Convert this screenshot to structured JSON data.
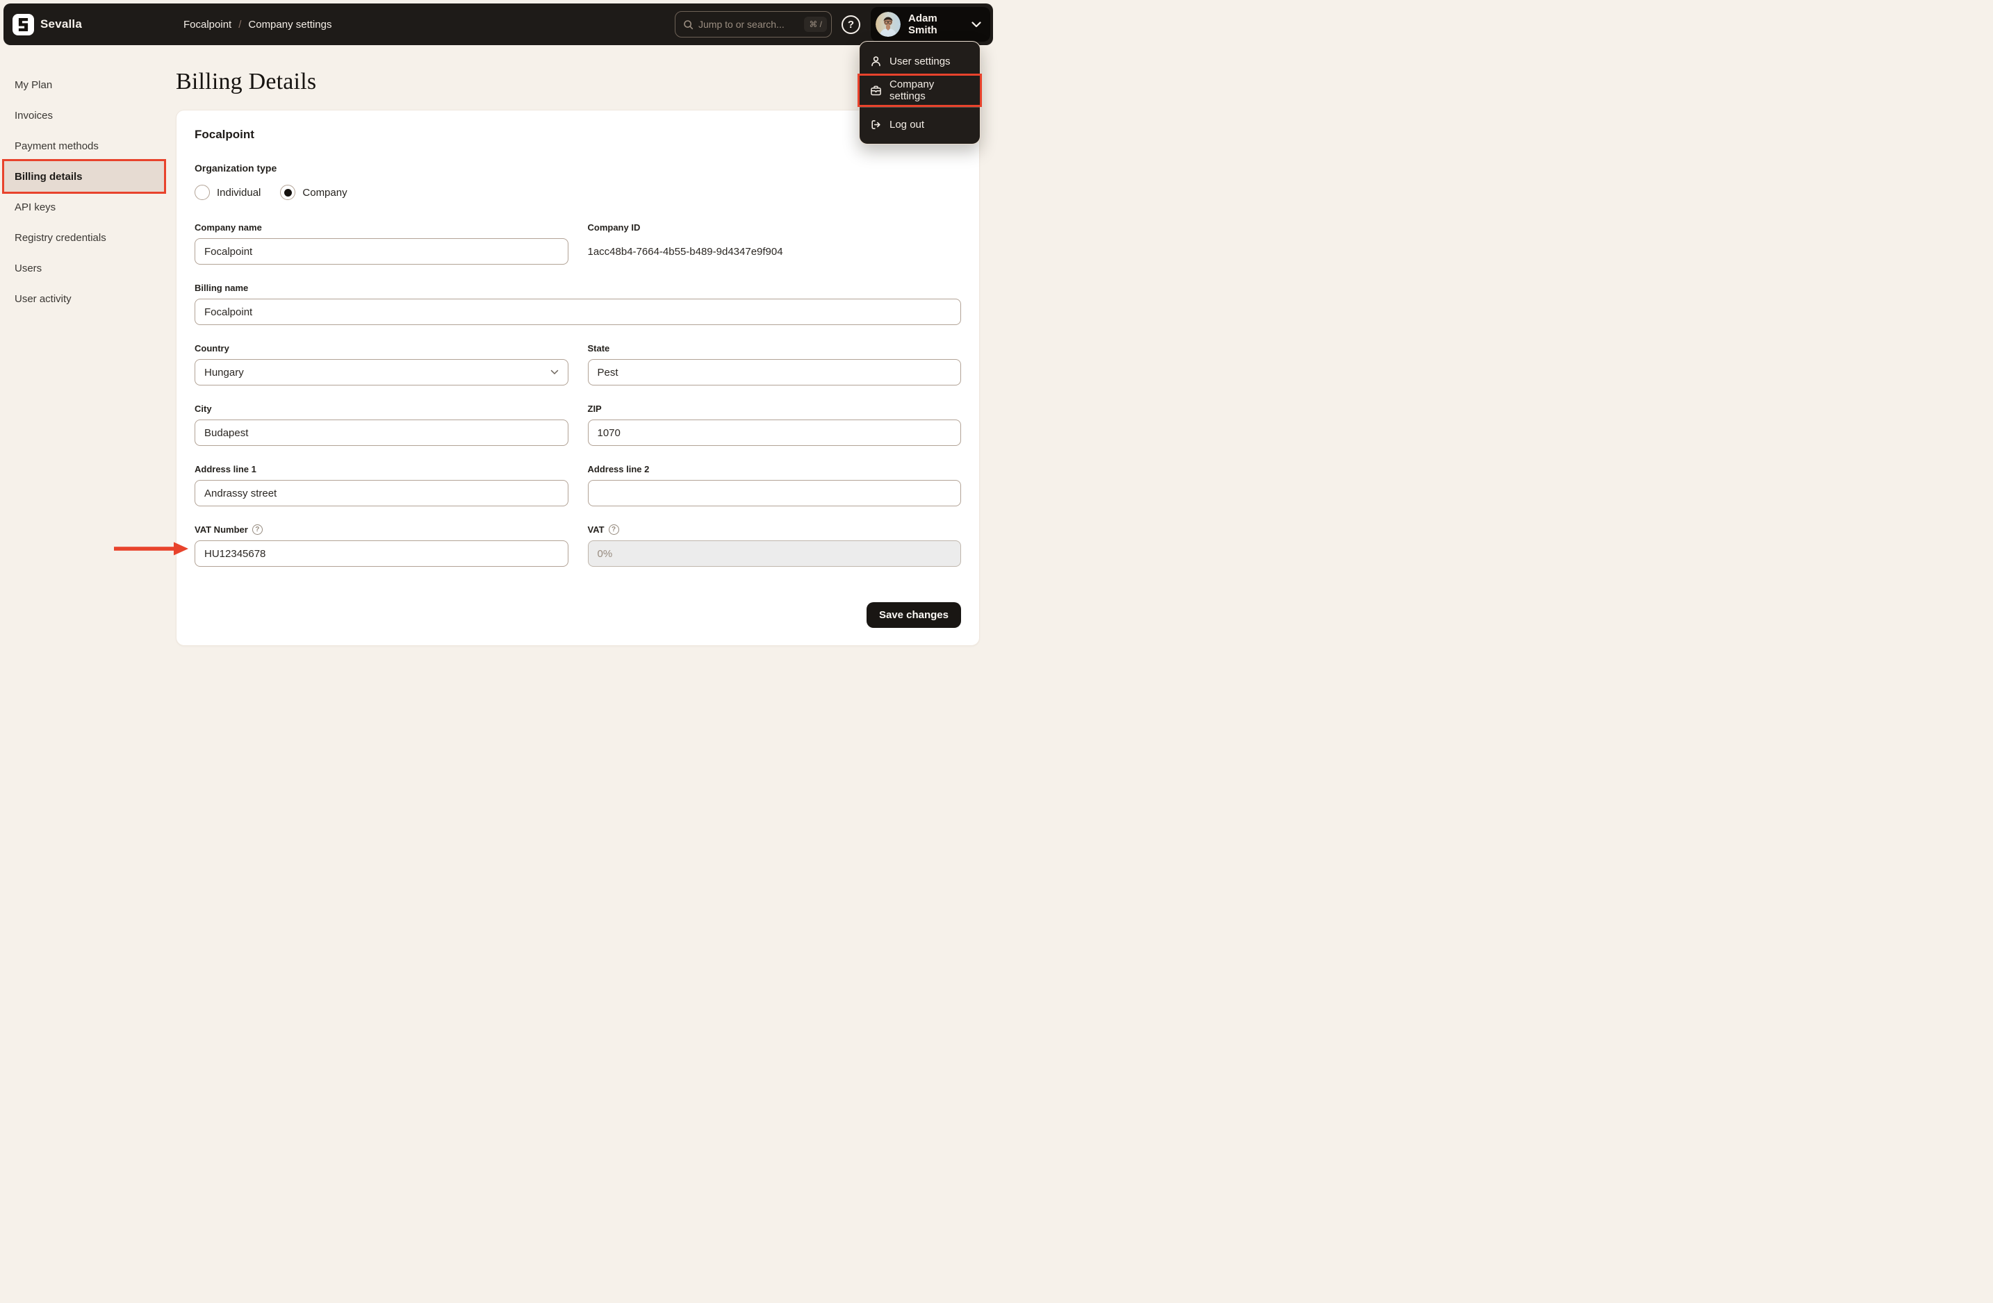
{
  "colors": {
    "page_bg": "#f6f1ea",
    "topbar_bg": "#1e1b18",
    "menu_bg": "#211d1a",
    "card_bg": "#ffffff",
    "accent_red": "#e8432c",
    "input_border": "#b2a396",
    "active_item_bg": "#e6dbd2",
    "text_dark": "#25221e",
    "text_muted": "#978b7f",
    "disabled_bg": "#ececec"
  },
  "icons": {
    "question": "?",
    "breadcrumb_separator": "/"
  },
  "topbar": {
    "brand": "Sevalla",
    "breadcrumb": [
      "Focalpoint",
      "Company settings"
    ],
    "search": {
      "placeholder": "Jump to or search...",
      "shortcut": "⌘ /"
    },
    "user_name": "Adam Smith"
  },
  "user_menu": {
    "items": [
      {
        "label": "User settings",
        "icon": "user-icon",
        "highlighted": false
      },
      {
        "label": "Company settings",
        "icon": "briefcase-icon",
        "highlighted": true
      },
      {
        "label": "Log out",
        "icon": "logout-icon",
        "highlighted": false
      }
    ]
  },
  "sidebar": {
    "items": [
      {
        "label": "My Plan",
        "active": false
      },
      {
        "label": "Invoices",
        "active": false
      },
      {
        "label": "Payment methods",
        "active": false
      },
      {
        "label": "Billing details",
        "active": true
      },
      {
        "label": "API keys",
        "active": false
      },
      {
        "label": "Registry credentials",
        "active": false
      },
      {
        "label": "Users",
        "active": false
      },
      {
        "label": "User activity",
        "active": false
      }
    ]
  },
  "page": {
    "title": "Billing Details"
  },
  "form": {
    "company_heading": "Focalpoint",
    "organization_type": {
      "label": "Organization type",
      "options": [
        {
          "label": "Individual",
          "selected": false
        },
        {
          "label": "Company",
          "selected": true
        }
      ]
    },
    "company_name": {
      "label": "Company name",
      "value": "Focalpoint"
    },
    "company_id": {
      "label": "Company ID",
      "value": "1acc48b4-7664-4b55-b489-9d4347e9f904"
    },
    "billing_name": {
      "label": "Billing name",
      "value": "Focalpoint"
    },
    "country": {
      "label": "Country",
      "value": "Hungary"
    },
    "state": {
      "label": "State",
      "value": "Pest"
    },
    "city": {
      "label": "City",
      "value": "Budapest"
    },
    "zip": {
      "label": "ZIP",
      "value": "1070"
    },
    "address1": {
      "label": "Address line 1",
      "value": "Andrassy street"
    },
    "address2": {
      "label": "Address line 2",
      "value": ""
    },
    "vat_number": {
      "label": "VAT Number",
      "value": "HU12345678"
    },
    "vat": {
      "label": "VAT",
      "value": "0%"
    },
    "save_label": "Save changes"
  }
}
